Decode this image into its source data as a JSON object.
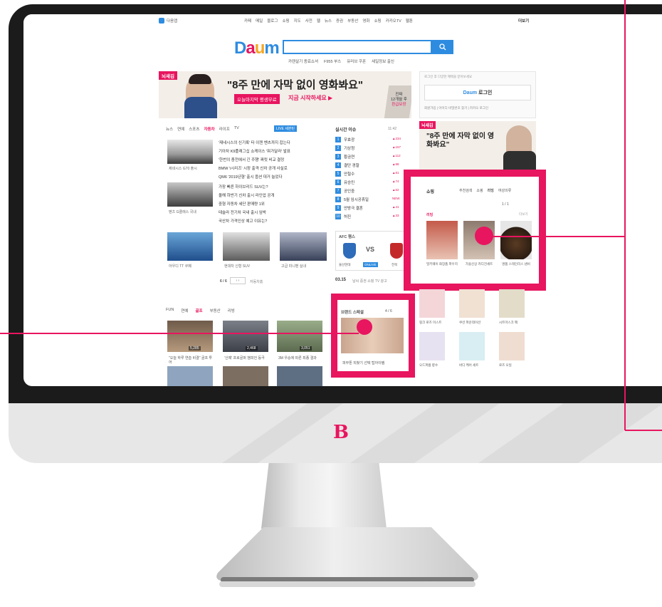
{
  "brand_mark": "B",
  "top_nav": {
    "service_label": "다음앱",
    "links": [
      "카페",
      "메일",
      "블로그",
      "쇼핑",
      "지도",
      "사전",
      "웹",
      "뉴스",
      "증권",
      "부동산",
      "영화",
      "쇼핑",
      "카카오TV",
      "웹툰"
    ],
    "more_label": "더보기"
  },
  "header": {
    "logo": "Daum",
    "search_placeholder": "",
    "search_icon": "search-icon",
    "keywords": [
      "카렌살기 종료쇼셔",
      "F955 부스",
      "유러브 쿠폰",
      "세일정보 출신"
    ]
  },
  "ad_banner": {
    "tag": "뇌새김",
    "headline": "\"8주 만에 자막 없이 영화봐요\"",
    "sub1": "오늘마지막 평생무료",
    "sub2": "지금 시작하세요 ▶",
    "side1": "진짜",
    "side2": "12개월 후",
    "side3": "환급보장"
  },
  "login": {
    "note": "로그인 후 다양한 혜택을 받아보세요",
    "button": "로그인",
    "links": "회원가입 | 아이디·비밀번호 찾기 | 카카오 로그인"
  },
  "news": {
    "tabs": [
      "뉴스",
      "연예",
      "스포츠",
      "자동차",
      "라이프",
      "TV"
    ],
    "active_tab": "자동차",
    "live_label": "LIVE 세븐틴",
    "headlines": [
      "'제네시스의 신기록' 타 이젠 벤츠까지 잡는다",
      "기아차 K9플래그십 쇼케이스 '뭐가달라' 발표",
      "'한번의 충전에서 긴 주행' 짜릿 비교 결정",
      "BMW 'i시리즈' 시장 출격 신차 공개 사실로",
      "QM6 '2019년형' 출시 옵션 대거 늘었다"
    ],
    "headlines2": [
      "가장 빠른 하이브리드 SUV는?",
      "올해 하반기 신차 출시 라인업 공개",
      "중형 자동차 세단 판매량 1위",
      "테슬라 전기차 국내 출시 임박",
      "국산차 가격인상 예고 이유는?"
    ],
    "captions": [
      "제네시스 G70 출시",
      "벤츠 G클래스 국내",
      "아우디 TT 쿠페",
      "현대차 신형 SUV",
      "고급 미니밴 실내"
    ],
    "pager": "6 / 6",
    "more": "자동차홈"
  },
  "realtime": {
    "title": "실시간 이슈",
    "time": "11:42",
    "items": [
      "우효광",
      "기상청",
      "황금연",
      "결단 경찰",
      "안철수",
      "유승민",
      "공인중",
      "5월 임시공휴일",
      "안방극 결혼",
      "허진"
    ],
    "deltas": [
      "▲234",
      "▲157",
      "▲112",
      "▲98",
      "▲81",
      "▲74",
      "▲62",
      "NEW",
      "▲41",
      "▲33"
    ]
  },
  "afc": {
    "title": "AFC 챔스",
    "vs": "VS",
    "team1": "울산현대",
    "team2": "ONLIVE",
    "team3": "전북"
  },
  "weather": {
    "date": "03.15",
    "links": "날씨 증권 쇼핑 TV 광고"
  },
  "brand_stamp": {
    "title": "브랜드 스페셜",
    "pager": "4 / 6",
    "caption": "피부톤 되찾기 선택 탑아이템"
  },
  "shopping": {
    "title": "쇼핑",
    "tabs": [
      "추천검색",
      "쇼핑",
      "리빙",
      "여성의류"
    ],
    "active_tab": "리빙",
    "pager": "1 / 1",
    "section": "리빙",
    "more": "더보기",
    "products": [
      "밀키웨이 화장품 파우치",
      "가을신상 카디건세트",
      "명품 스테인리스 냄비"
    ],
    "products2": [
      "핑크 로즈 미스트",
      "쿠션 파운데이션",
      "시트마스크 팩",
      "오드퍼퓸 향수",
      "바디 케어 세트",
      "로즈 오일"
    ]
  },
  "videos": {
    "tabs": [
      "FUN",
      "연예",
      "골프",
      "부동산",
      "리빙"
    ],
    "active_tab": "골프",
    "views": [
      "5,285",
      "2,468",
      "3,051"
    ],
    "captions": [
      "\"오늘 하루 연습 비결\" 골프 투어",
      "'신예' 프로골퍼 챔피언 등극",
      "3M 우승에 따른 최종 결과"
    ]
  },
  "colors": {
    "accent": "#e8155f",
    "daum_blue": "#2e8ce0",
    "bezel": "#1b1b1b",
    "chin": "#e7e7e7"
  }
}
